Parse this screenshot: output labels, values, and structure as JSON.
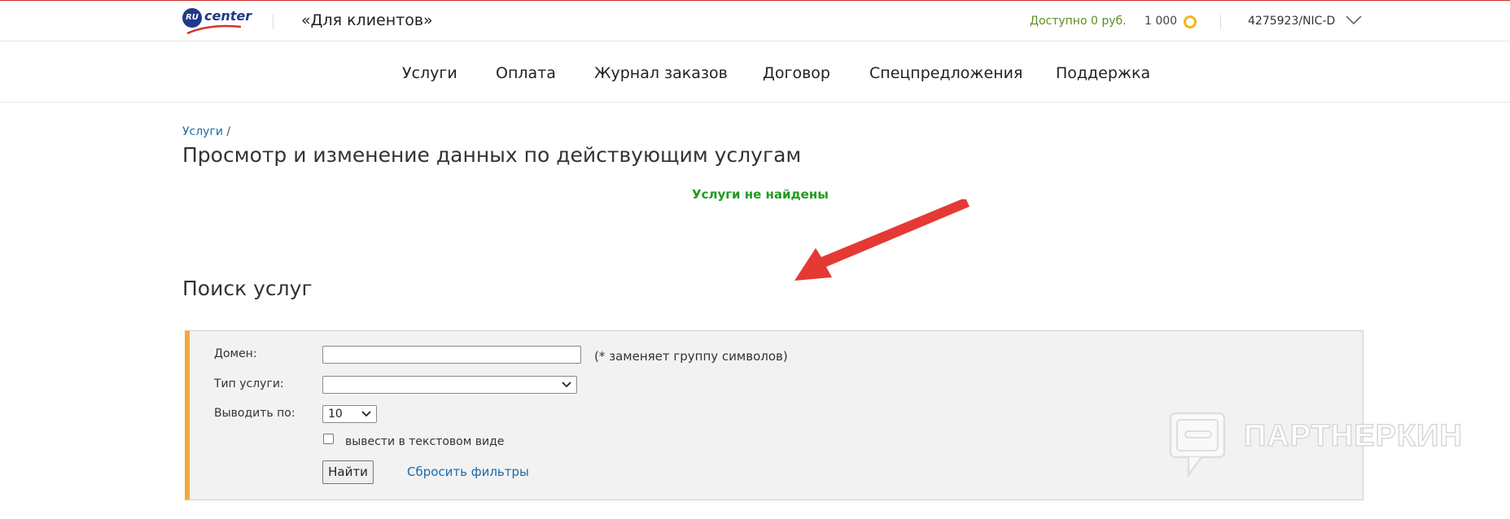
{
  "header": {
    "logo_badge": "RU",
    "logo_word": "center",
    "section_title": "«Для клиентов»",
    "balance": "Доступно 0 руб.",
    "bonus": "1 000",
    "account": "4275923/NIC-D"
  },
  "nav": [
    "Услуги",
    "Оплата",
    "Журнал заказов",
    "Договор",
    "Спецпредложения",
    "Поддержка"
  ],
  "breadcrumb": {
    "link": "Услуги",
    "sep": "/"
  },
  "page_title": "Просмотр и изменение данных по действующим услугам",
  "status_message": "Услуги не найдены",
  "search": {
    "title": "Поиск услуг",
    "domain_label": "Домен:",
    "domain_value": "",
    "domain_hint": "(* заменяет группу символов)",
    "type_label": "Тип услуги:",
    "type_value": "",
    "perpage_label": "Выводить по:",
    "perpage_value": "10",
    "text_mode_label": "вывести в текстовом виде",
    "find_button": "Найти",
    "reset_link": "Сбросить фильтры"
  },
  "watermark": "ПАРТНЕРКИН",
  "colors": {
    "accent_orange": "#f2a93b",
    "success_green": "#1e9d1e",
    "link_blue": "#1a6ba8",
    "arrow_red": "#e53935"
  }
}
